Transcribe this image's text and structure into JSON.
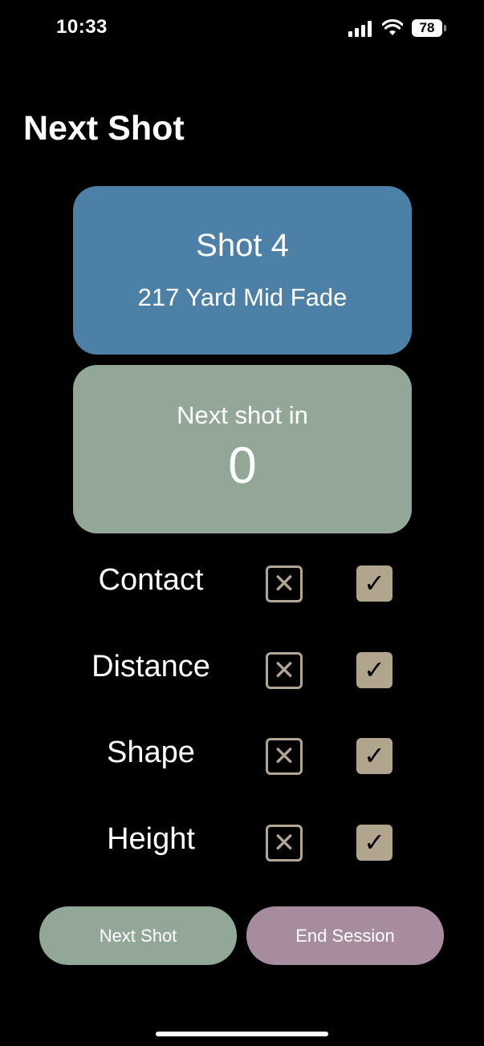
{
  "status_bar": {
    "time": "10:33",
    "battery_level": "78"
  },
  "page": {
    "title": "Next Shot"
  },
  "shot_card": {
    "shot_label": "Shot 4",
    "description": "217 Yard Mid Fade",
    "color": "#4d80a6"
  },
  "timer_card": {
    "label": "Next shot in",
    "value": "0",
    "color": "#93a797"
  },
  "metrics": [
    {
      "label": "Contact",
      "fail_icon": "x-icon",
      "pass_icon": "check-icon"
    },
    {
      "label": "Distance",
      "fail_icon": "x-icon",
      "pass_icon": "check-icon"
    },
    {
      "label": "Shape",
      "fail_icon": "x-icon",
      "pass_icon": "check-icon"
    },
    {
      "label": "Height",
      "fail_icon": "x-icon",
      "pass_icon": "check-icon"
    }
  ],
  "buttons": {
    "next_shot": "Next Shot",
    "end_session": "End Session",
    "next_color": "#93a797",
    "end_color": "#a78ca0"
  }
}
